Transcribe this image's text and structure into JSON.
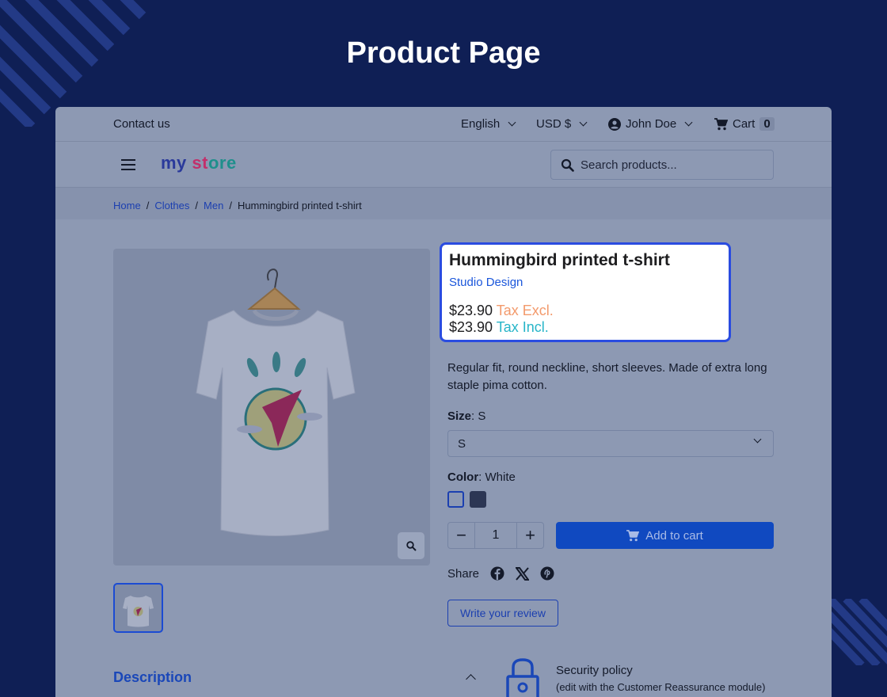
{
  "page_heading": "Product Page",
  "topbar": {
    "contact": "Contact us",
    "language": "English",
    "currency": "USD $",
    "user": "John Doe",
    "cart_label": "Cart",
    "cart_count": "0"
  },
  "header": {
    "logo_part1": "my ",
    "logo_part2": "st",
    "logo_part3": "ore",
    "search_placeholder": "Search products..."
  },
  "breadcrumb": {
    "items": [
      "Home",
      "Clothes",
      "Men"
    ],
    "current": "Hummingbird printed t-shirt"
  },
  "product": {
    "title": "Hummingbird printed t-shirt",
    "brand": "Studio Design",
    "price_excl": "$23.90",
    "tax_excl_label": "Tax Excl.",
    "price_incl": "$23.90",
    "tax_incl_label": "Tax Incl.",
    "description": "Regular fit, round neckline, short sleeves. Made of extra long staple pima cotton.",
    "size_label": "Size",
    "size_value": "S",
    "size_selected": "S",
    "color_label": "Color",
    "color_value": "White",
    "swatches": [
      {
        "name": "White",
        "color": "#8d99b3"
      },
      {
        "name": "Dark",
        "color": "#2c3654"
      }
    ],
    "quantity": "1",
    "add_to_cart": "Add to cart",
    "share_label": "Share",
    "review_button": "Write your review"
  },
  "description_section": {
    "heading": "Description"
  },
  "reassurance": {
    "title": "Security policy",
    "subtitle": "(edit with the Customer Reassurance module)"
  },
  "colors": {
    "background": "#0f1f55",
    "accent": "#1049c0",
    "highlight_border": "#2a4ce0"
  }
}
